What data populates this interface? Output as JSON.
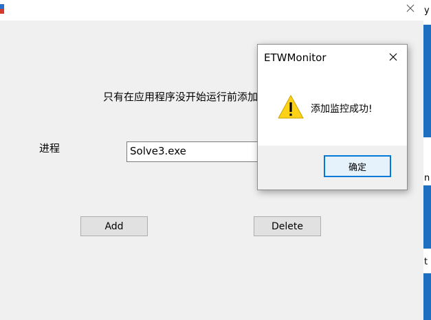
{
  "main_window": {
    "instruction": "只有在应用程序没开始运行前添加",
    "process_label": "进程",
    "process_value": "Solve3.exe",
    "add_label": "Add",
    "delete_label": "Delete",
    "close_icon": "close-icon"
  },
  "background_window": {
    "fragments": [
      "y",
      "n",
      "t"
    ]
  },
  "message_box": {
    "title": "ETWMonitor",
    "message": "添加监控成功!",
    "ok_label": "确定",
    "icon": "warning-icon"
  },
  "colors": {
    "accent": "#0078d7",
    "warning": "#fcd116",
    "window_bg": "#f0f0f0"
  }
}
